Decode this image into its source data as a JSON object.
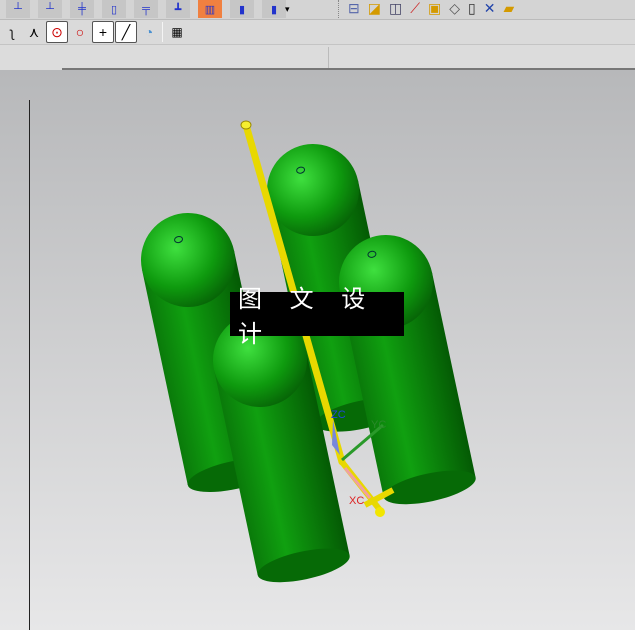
{
  "toolbar_top": {
    "icons": [
      "mold-tool-1",
      "mold-tool-2",
      "mold-tool-3",
      "mold-tool-4",
      "mold-tool-5",
      "mold-tool-6",
      "mold-tool-7",
      "mold-tool-8",
      "mold-tool-9"
    ],
    "right_icons": [
      "assembly-navigator",
      "part",
      "drafting",
      "wcs",
      "solid-box",
      "view-section",
      "layout",
      "tools",
      "mold-wizard"
    ],
    "overflow": "▾"
  },
  "snap_toolbar": {
    "icons": [
      "curve-point",
      "intersection-point",
      "arc-center",
      "quadrant-point",
      "existing-point",
      "point-on-curve",
      "point-on-face",
      "grid"
    ]
  },
  "viewport": {
    "banner_text": "图 文 设 计",
    "axes": {
      "z": "ZC",
      "y": "YC",
      "x": "XC"
    },
    "colors": {
      "body": "#0a8a0a",
      "rod": "#f2e600"
    }
  }
}
